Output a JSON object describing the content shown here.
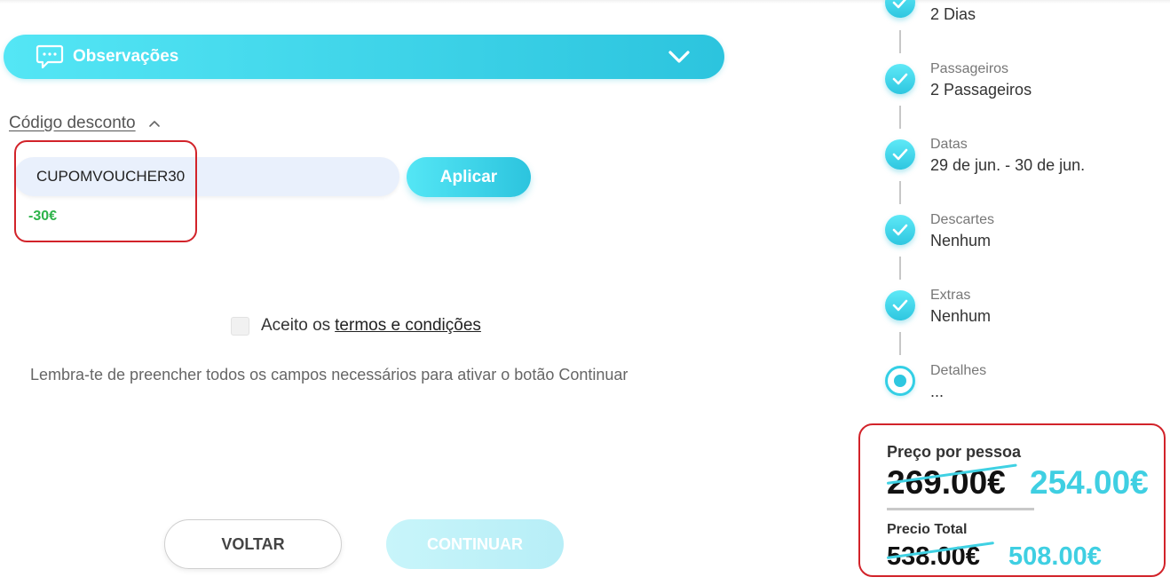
{
  "observations": {
    "label": "Observações",
    "icon": "chat-bubble-icon",
    "toggle_icon": "chevron-down-icon"
  },
  "discount": {
    "toggle_label": "Código desconto",
    "toggle_icon": "chevron-up-icon",
    "code_value": "CUPOMVOUCHER30",
    "apply_label": "Aplicar",
    "result": "-30€"
  },
  "terms": {
    "prefix": "Aceito os",
    "link": "termos e condições",
    "checked": false
  },
  "reminder": "Lembra-te de preencher todos os campos necessários para ativar o botão Continuar",
  "buttons": {
    "back": "VOLTAR",
    "continue": "CONTINUAR"
  },
  "steps": [
    {
      "label": "",
      "value": "2 Dias",
      "status": "done"
    },
    {
      "label": "Passageiros",
      "value": "2 Passageiros",
      "status": "done"
    },
    {
      "label": "Datas",
      "value": "29 de jun. - 30 de jun.",
      "status": "done"
    },
    {
      "label": "Descartes",
      "value": "Nenhum",
      "status": "done"
    },
    {
      "label": "Extras",
      "value": "Nenhum",
      "status": "done"
    },
    {
      "label": "Detalhes",
      "value": "...",
      "status": "current"
    }
  ],
  "prices": {
    "per_person_label": "Preço por pessoa",
    "per_person_old": "269.00€",
    "per_person_new": "254.00€",
    "total_label": "Precio Total",
    "total_old": "538.00€",
    "total_new": "508.00€"
  },
  "colors": {
    "accent": "#2cc4de",
    "accent_light": "#54e6f5",
    "discount_green": "#2db34a",
    "highlight_red": "#d2232a"
  }
}
